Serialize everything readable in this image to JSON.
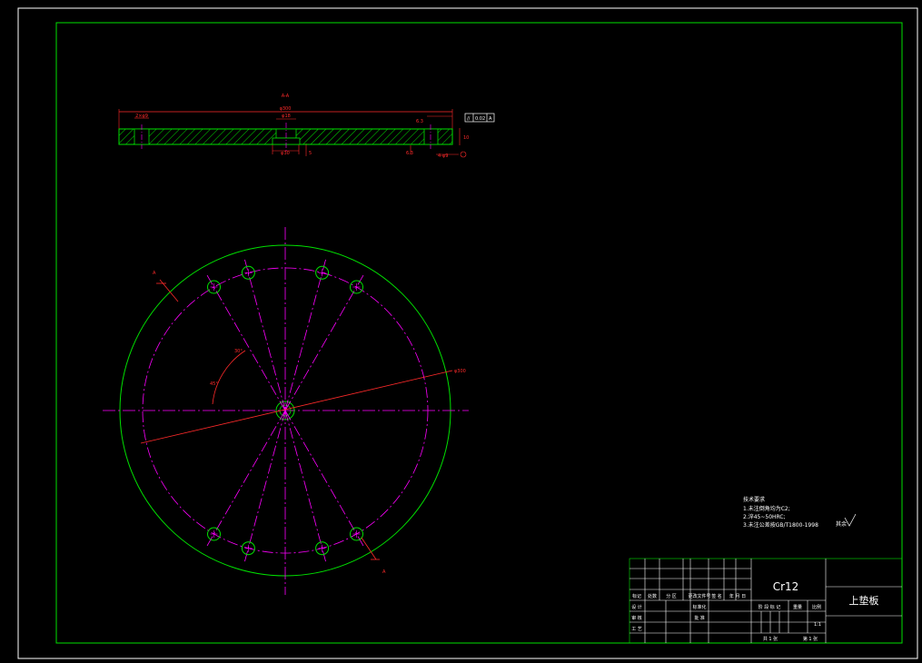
{
  "drawing": {
    "section_label": "A-A",
    "section_mark": "A",
    "colors": {
      "background": "#000000",
      "border": "#ffffff",
      "outline": "#00e000",
      "centerline": "#ff00ff",
      "dimension": "#ff2a2a"
    }
  },
  "notes": {
    "lines": [
      "技术要求",
      "1.未注倒角均为C2;",
      "2.淬45~50HRC;",
      "3.未注公差按GB/T1800-1998"
    ],
    "roughness": "其余"
  },
  "title_block": {
    "material": "Cr12",
    "part_name": "上垫板",
    "scale": "1:1",
    "headers": [
      "标记",
      "处数",
      "分 区",
      "更改文件号",
      "签 名",
      "年 月 日"
    ],
    "rows": [
      "设 计",
      "标准化",
      "审 核",
      "工 艺",
      "批 准"
    ],
    "stage_labels": [
      "阶 段 标 记",
      "重量",
      "比例"
    ],
    "sheet_info": [
      "共 1 张",
      "第 1 张"
    ]
  }
}
